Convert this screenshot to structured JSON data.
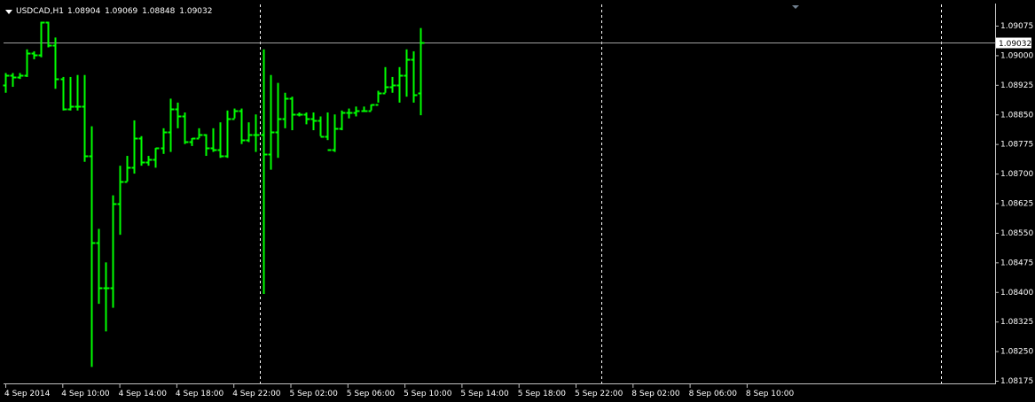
{
  "header": {
    "symbol": "USDCAD,H1",
    "open": "1.08904",
    "high": "1.09069",
    "low": "1.08848",
    "close": "1.09032"
  },
  "colors": {
    "background": "#000000",
    "bars": "#00ff00",
    "grid": "#c0c0c0",
    "text": "#ffffff",
    "price_line": "#a0a0a0"
  },
  "chart_data": {
    "type": "ohlc",
    "symbol": "USDCAD",
    "timeframe": "H1",
    "current_price": "1.09032",
    "y_ticks": [
      "1.09075",
      "1.09000",
      "1.08925",
      "1.08850",
      "1.08775",
      "1.08700",
      "1.08625",
      "1.08550",
      "1.08475",
      "1.08400",
      "1.08325",
      "1.08250",
      "1.08175"
    ],
    "y_range": [
      1.0817,
      1.091
    ],
    "x_ticks": [
      "4 Sep 2014",
      "4 Sep 10:00",
      "4 Sep 14:00",
      "4 Sep 18:00",
      "4 Sep 22:00",
      "5 Sep 02:00",
      "5 Sep 06:00",
      "5 Sep 10:00",
      "5 Sep 14:00",
      "5 Sep 18:00",
      "5 Sep 22:00",
      "8 Sep 02:00",
      "8 Sep 06:00",
      "8 Sep 10:00"
    ],
    "session_separators_after_tick": [
      4,
      10,
      13
    ],
    "bars": [
      {
        "o": 1.08925,
        "h": 1.08955,
        "l": 1.08905,
        "c": 1.0895
      },
      {
        "o": 1.0895,
        "h": 1.08955,
        "l": 1.0892,
        "c": 1.08945
      },
      {
        "o": 1.08945,
        "h": 1.08955,
        "l": 1.0894,
        "c": 1.0895
      },
      {
        "o": 1.0895,
        "h": 1.09015,
        "l": 1.08945,
        "c": 1.09005
      },
      {
        "o": 1.09005,
        "h": 1.0901,
        "l": 1.0899,
        "c": 1.09
      },
      {
        "o": 1.09,
        "h": 1.09085,
        "l": 1.08995,
        "c": 1.09085
      },
      {
        "o": 1.09085,
        "h": 1.09085,
        "l": 1.0902,
        "c": 1.09025
      },
      {
        "o": 1.09025,
        "h": 1.09045,
        "l": 1.08915,
        "c": 1.0894
      },
      {
        "o": 1.0894,
        "h": 1.08945,
        "l": 1.0886,
        "c": 1.08865
      },
      {
        "o": 1.08865,
        "h": 1.08945,
        "l": 1.0886,
        "c": 1.0887
      },
      {
        "o": 1.0887,
        "h": 1.0895,
        "l": 1.0886,
        "c": 1.0887
      },
      {
        "o": 1.0887,
        "h": 1.0895,
        "l": 1.0873,
        "c": 1.08745
      },
      {
        "o": 1.08745,
        "h": 1.0882,
        "l": 1.0821,
        "c": 1.08525
      },
      {
        "o": 1.08525,
        "h": 1.0856,
        "l": 1.0837,
        "c": 1.0841
      },
      {
        "o": 1.0841,
        "h": 1.08475,
        "l": 1.083,
        "c": 1.0841
      },
      {
        "o": 1.0841,
        "h": 1.08645,
        "l": 1.0836,
        "c": 1.08625
      },
      {
        "o": 1.08625,
        "h": 1.0872,
        "l": 1.08545,
        "c": 1.0868
      },
      {
        "o": 1.0868,
        "h": 1.08745,
        "l": 1.0868,
        "c": 1.08715
      },
      {
        "o": 1.08715,
        "h": 1.08835,
        "l": 1.087,
        "c": 1.0879
      },
      {
        "o": 1.0879,
        "h": 1.08795,
        "l": 1.0872,
        "c": 1.0873
      },
      {
        "o": 1.0873,
        "h": 1.08745,
        "l": 1.0872,
        "c": 1.08735
      },
      {
        "o": 1.08735,
        "h": 1.08765,
        "l": 1.08715,
        "c": 1.08765
      },
      {
        "o": 1.08765,
        "h": 1.08815,
        "l": 1.0875,
        "c": 1.08805
      },
      {
        "o": 1.08805,
        "h": 1.0889,
        "l": 1.08755,
        "c": 1.08865
      },
      {
        "o": 1.08865,
        "h": 1.0888,
        "l": 1.08815,
        "c": 1.08845
      },
      {
        "o": 1.08845,
        "h": 1.08855,
        "l": 1.08775,
        "c": 1.0878
      },
      {
        "o": 1.0878,
        "h": 1.0879,
        "l": 1.0877,
        "c": 1.0879
      },
      {
        "o": 1.0879,
        "h": 1.08815,
        "l": 1.0879,
        "c": 1.088
      },
      {
        "o": 1.088,
        "h": 1.088,
        "l": 1.08745,
        "c": 1.08765
      },
      {
        "o": 1.08765,
        "h": 1.08815,
        "l": 1.08755,
        "c": 1.0876
      },
      {
        "o": 1.0876,
        "h": 1.0883,
        "l": 1.0874,
        "c": 1.08745
      },
      {
        "o": 1.08745,
        "h": 1.0886,
        "l": 1.0874,
        "c": 1.0884
      },
      {
        "o": 1.0884,
        "h": 1.08865,
        "l": 1.0884,
        "c": 1.0886
      },
      {
        "o": 1.0886,
        "h": 1.08865,
        "l": 1.08775,
        "c": 1.08785
      },
      {
        "o": 1.08785,
        "h": 1.0883,
        "l": 1.0878,
        "c": 1.088
      },
      {
        "o": 1.088,
        "h": 1.0885,
        "l": 1.08755,
        "c": 1.088
      },
      {
        "o": 1.088,
        "h": 1.09015,
        "l": 1.08395,
        "c": 1.0875
      },
      {
        "o": 1.0875,
        "h": 1.0895,
        "l": 1.0871,
        "c": 1.08805
      },
      {
        "o": 1.08805,
        "h": 1.0893,
        "l": 1.0874,
        "c": 1.0884
      },
      {
        "o": 1.0884,
        "h": 1.08905,
        "l": 1.08815,
        "c": 1.0889
      },
      {
        "o": 1.0889,
        "h": 1.08895,
        "l": 1.0881,
        "c": 1.0885
      },
      {
        "o": 1.0885,
        "h": 1.08855,
        "l": 1.08845,
        "c": 1.0885
      },
      {
        "o": 1.0885,
        "h": 1.08855,
        "l": 1.08825,
        "c": 1.0884
      },
      {
        "o": 1.0884,
        "h": 1.08855,
        "l": 1.0881,
        "c": 1.08835
      },
      {
        "o": 1.08835,
        "h": 1.08845,
        "l": 1.08795,
        "c": 1.08795
      },
      {
        "o": 1.08795,
        "h": 1.08855,
        "l": 1.08785,
        "c": 1.0876
      },
      {
        "o": 1.0876,
        "h": 1.0885,
        "l": 1.08755,
        "c": 1.08815
      },
      {
        "o": 1.08815,
        "h": 1.0886,
        "l": 1.0881,
        "c": 1.08855
      },
      {
        "o": 1.08855,
        "h": 1.08865,
        "l": 1.0884,
        "c": 1.08855
      },
      {
        "o": 1.08855,
        "h": 1.0887,
        "l": 1.08845,
        "c": 1.0886
      },
      {
        "o": 1.0886,
        "h": 1.0887,
        "l": 1.0886,
        "c": 1.0886
      },
      {
        "o": 1.0886,
        "h": 1.08875,
        "l": 1.0886,
        "c": 1.08875
      },
      {
        "o": 1.08875,
        "h": 1.0891,
        "l": 1.0888,
        "c": 1.08905
      },
      {
        "o": 1.08905,
        "h": 1.0897,
        "l": 1.08905,
        "c": 1.0892
      },
      {
        "o": 1.0892,
        "h": 1.08945,
        "l": 1.08905,
        "c": 1.08925
      },
      {
        "o": 1.08925,
        "h": 1.0897,
        "l": 1.0888,
        "c": 1.0895
      },
      {
        "o": 1.0895,
        "h": 1.09015,
        "l": 1.08895,
        "c": 1.0899
      },
      {
        "o": 1.0899,
        "h": 1.0901,
        "l": 1.0888,
        "c": 1.089
      },
      {
        "o": 1.08904,
        "h": 1.09069,
        "l": 1.08848,
        "c": 1.09032
      }
    ]
  }
}
